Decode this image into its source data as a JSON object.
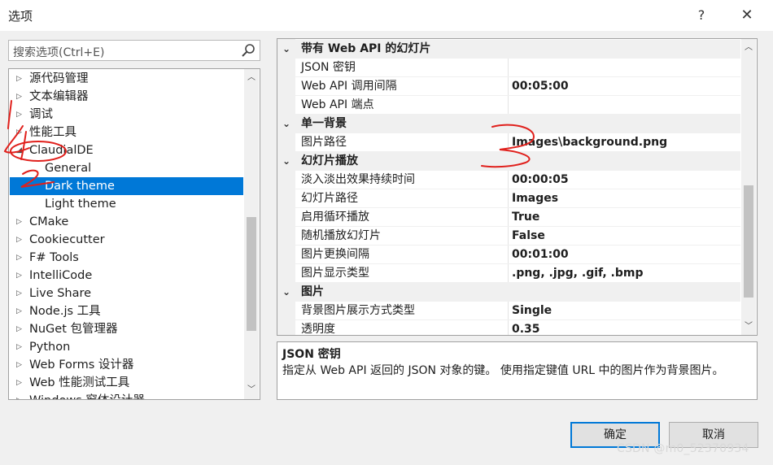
{
  "window": {
    "title": "选项",
    "help_label": "?",
    "close_label": "✕"
  },
  "search": {
    "placeholder": "搜索选项(Ctrl+E)"
  },
  "tree": {
    "items": [
      {
        "label": "源代码管理",
        "arrow": "▷"
      },
      {
        "label": "文本编辑器",
        "arrow": "▷"
      },
      {
        "label": "调试",
        "arrow": "▷"
      },
      {
        "label": "性能工具",
        "arrow": "▷"
      },
      {
        "label": "ClaudialDE",
        "arrow": "◢"
      },
      {
        "label": "General",
        "arrow": ""
      },
      {
        "label": "Dark theme",
        "arrow": ""
      },
      {
        "label": "Light theme",
        "arrow": ""
      },
      {
        "label": "CMake",
        "arrow": "▷"
      },
      {
        "label": "Cookiecutter",
        "arrow": "▷"
      },
      {
        "label": "F# Tools",
        "arrow": "▷"
      },
      {
        "label": "IntelliCode",
        "arrow": "▷"
      },
      {
        "label": "Live Share",
        "arrow": "▷"
      },
      {
        "label": "Node.js 工具",
        "arrow": "▷"
      },
      {
        "label": "NuGet 包管理器",
        "arrow": "▷"
      },
      {
        "label": "Python",
        "arrow": "▷"
      },
      {
        "label": "Web Forms 设计器",
        "arrow": "▷"
      },
      {
        "label": "Web 性能测试工具",
        "arrow": "▷"
      },
      {
        "label": "Windows 窗体设计器",
        "arrow": "▷"
      }
    ]
  },
  "grid": {
    "categories": [
      {
        "label": "带有 Web API 的幻灯片",
        "rows": [
          {
            "name": "JSON 密钥",
            "value": ""
          },
          {
            "name": "Web API 调用间隔",
            "value": "00:05:00"
          },
          {
            "name": "Web API 端点",
            "value": ""
          }
        ]
      },
      {
        "label": "单一背景",
        "rows": [
          {
            "name": "图片路径",
            "value": "Images\\background.png"
          }
        ]
      },
      {
        "label": "幻灯片播放",
        "rows": [
          {
            "name": "淡入淡出效果持续时间",
            "value": "00:00:05"
          },
          {
            "name": "幻灯片路径",
            "value": "Images"
          },
          {
            "name": "启用循环播放",
            "value": "True"
          },
          {
            "name": "随机播放幻灯片",
            "value": "False"
          },
          {
            "name": "图片更换间隔",
            "value": "00:01:00"
          },
          {
            "name": "图片显示类型",
            "value": ".png, .jpg, .gif, .bmp"
          }
        ]
      },
      {
        "label": "图片",
        "rows": [
          {
            "name": "背景图片展示方式类型",
            "value": "Single"
          },
          {
            "name": "透明度",
            "value": "0.35"
          }
        ]
      }
    ]
  },
  "description": {
    "title": "JSON 密钥",
    "text": "指定从 Web API 返回的 JSON 对象的键。 使用指定键值 URL 中的图片作为背景图片。"
  },
  "buttons": {
    "ok": "确定",
    "cancel": "取消"
  },
  "watermark": "CSDN @m0_52370934",
  "colors": {
    "selection": "#0078d7",
    "annotation": "#e0201c"
  }
}
